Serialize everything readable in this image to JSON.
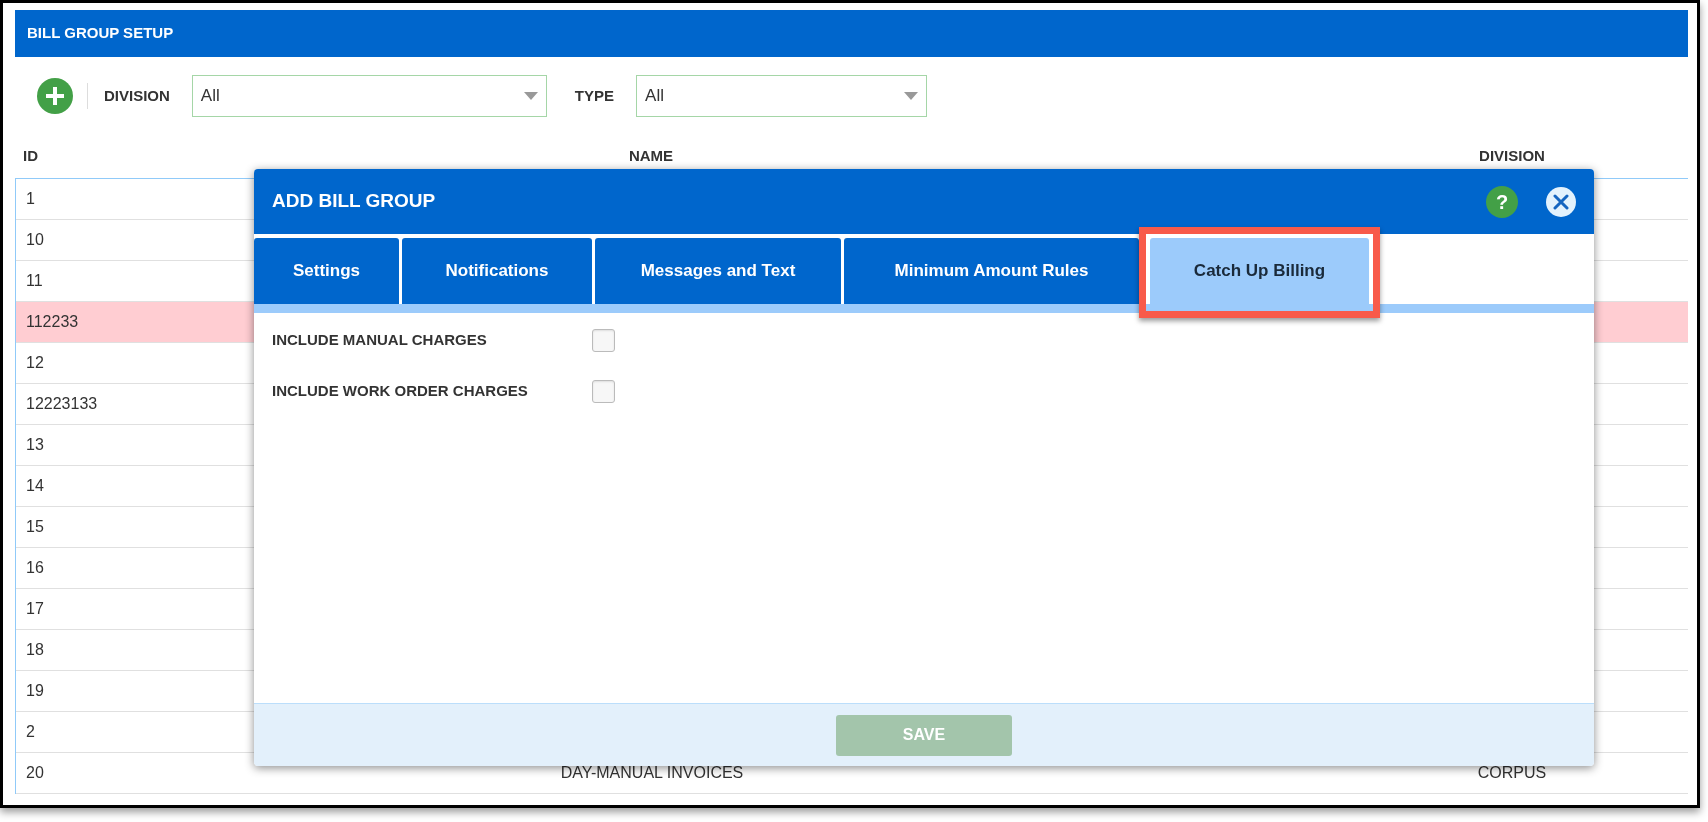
{
  "page": {
    "title": "BILL GROUP SETUP"
  },
  "filters": [
    {
      "label": "DIVISION",
      "value": "All"
    },
    {
      "label": "TYPE",
      "value": "All"
    }
  ],
  "table": {
    "columns": [
      "ID",
      "NAME",
      "DIVISION"
    ],
    "rows": [
      {
        "id": "1",
        "highlighted": false
      },
      {
        "id": "10",
        "highlighted": false
      },
      {
        "id": "11",
        "highlighted": false
      },
      {
        "id": "112233",
        "highlighted": true
      },
      {
        "id": "12",
        "highlighted": false
      },
      {
        "id": "12223133",
        "highlighted": false
      },
      {
        "id": "13",
        "highlighted": false
      },
      {
        "id": "14",
        "highlighted": false
      },
      {
        "id": "15",
        "highlighted": false
      },
      {
        "id": "16",
        "highlighted": false
      },
      {
        "id": "17",
        "highlighted": false
      },
      {
        "id": "18",
        "highlighted": false
      },
      {
        "id": "19",
        "highlighted": false
      },
      {
        "id": "2",
        "highlighted": false
      },
      {
        "id": "20",
        "name": "DAY-MANUAL INVOICES",
        "division": "CORPUS",
        "highlighted": false
      }
    ]
  },
  "dialog": {
    "title": "ADD BILL GROUP",
    "help": "?",
    "tabs": [
      {
        "label": "Settings",
        "selected": false
      },
      {
        "label": "Notifications",
        "selected": false
      },
      {
        "label": "Messages and Text",
        "selected": false
      },
      {
        "label": "Minimum Amount Rules",
        "selected": false
      },
      {
        "label": "Catch Up Billing",
        "selected": true
      }
    ],
    "fields": [
      {
        "label": "INCLUDE MANUAL CHARGES",
        "checked": false
      },
      {
        "label": "INCLUDE WORK ORDER CHARGES",
        "checked": false
      }
    ],
    "save_button": {
      "label": "SAVE",
      "disabled": true
    }
  }
}
